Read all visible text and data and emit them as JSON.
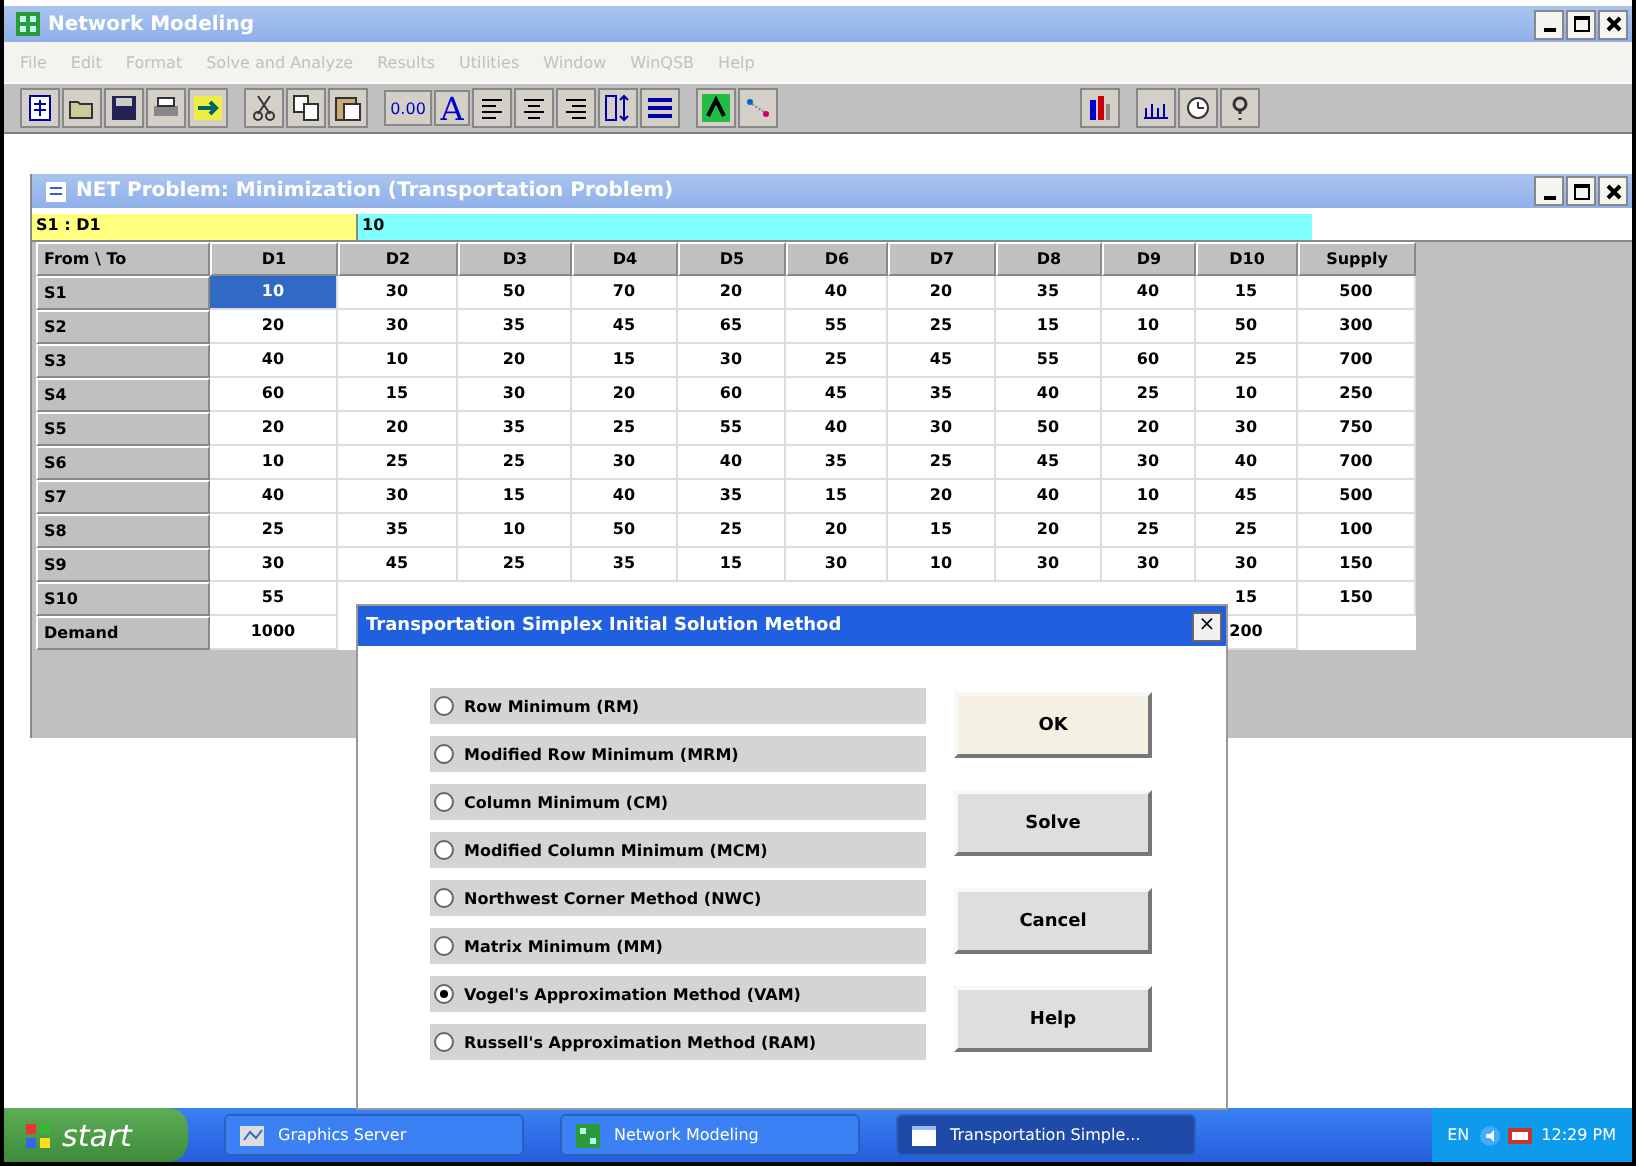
{
  "window": {
    "title": "Network Modeling"
  },
  "menu": [
    "File",
    "Edit",
    "Format",
    "Solve and Analyze",
    "Results",
    "Utilities",
    "Window",
    "WinQSB",
    "Help"
  ],
  "toolbar": {
    "number_format": "0.00",
    "font": "A"
  },
  "child_window": {
    "title": "NET Problem: Minimization (Transportation Problem)"
  },
  "formula_bar": {
    "cell": "S1 : D1",
    "value": "10"
  },
  "table": {
    "corner": "From \\ To",
    "columns": [
      "D1",
      "D2",
      "D3",
      "D4",
      "D5",
      "D6",
      "D7",
      "D8",
      "D9",
      "D10",
      "Supply"
    ],
    "rows": [
      {
        "label": "S1",
        "cells": [
          {
            "text": "10",
            "selected": true
          },
          {
            "text": "30",
            "selected": false
          },
          {
            "text": "50",
            "selected": false
          },
          {
            "text": "70",
            "selected": false
          },
          {
            "text": "20",
            "selected": false
          },
          {
            "text": "40",
            "selected": false
          },
          {
            "text": "20",
            "selected": false
          },
          {
            "text": "35",
            "selected": false
          },
          {
            "text": "40",
            "selected": false
          },
          {
            "text": "15",
            "selected": false
          },
          {
            "text": "500",
            "selected": false
          }
        ]
      },
      {
        "label": "S2",
        "cells": [
          {
            "text": "20",
            "selected": false
          },
          {
            "text": "30",
            "selected": false
          },
          {
            "text": "35",
            "selected": false
          },
          {
            "text": "45",
            "selected": false
          },
          {
            "text": "65",
            "selected": false
          },
          {
            "text": "55",
            "selected": false
          },
          {
            "text": "25",
            "selected": false
          },
          {
            "text": "15",
            "selected": false
          },
          {
            "text": "10",
            "selected": false
          },
          {
            "text": "50",
            "selected": false
          },
          {
            "text": "300",
            "selected": false
          }
        ]
      },
      {
        "label": "S3",
        "cells": [
          {
            "text": "40",
            "selected": false
          },
          {
            "text": "10",
            "selected": false
          },
          {
            "text": "20",
            "selected": false
          },
          {
            "text": "15",
            "selected": false
          },
          {
            "text": "30",
            "selected": false
          },
          {
            "text": "25",
            "selected": false
          },
          {
            "text": "45",
            "selected": false
          },
          {
            "text": "55",
            "selected": false
          },
          {
            "text": "60",
            "selected": false
          },
          {
            "text": "25",
            "selected": false
          },
          {
            "text": "700",
            "selected": false
          }
        ]
      },
      {
        "label": "S4",
        "cells": [
          {
            "text": "60",
            "selected": false
          },
          {
            "text": "15",
            "selected": false
          },
          {
            "text": "30",
            "selected": false
          },
          {
            "text": "20",
            "selected": false
          },
          {
            "text": "60",
            "selected": false
          },
          {
            "text": "45",
            "selected": false
          },
          {
            "text": "35",
            "selected": false
          },
          {
            "text": "40",
            "selected": false
          },
          {
            "text": "25",
            "selected": false
          },
          {
            "text": "10",
            "selected": false
          },
          {
            "text": "250",
            "selected": false
          }
        ]
      },
      {
        "label": "S5",
        "cells": [
          {
            "text": "20",
            "selected": false
          },
          {
            "text": "20",
            "selected": false
          },
          {
            "text": "35",
            "selected": false
          },
          {
            "text": "25",
            "selected": false
          },
          {
            "text": "55",
            "selected": false
          },
          {
            "text": "40",
            "selected": false
          },
          {
            "text": "30",
            "selected": false
          },
          {
            "text": "50",
            "selected": false
          },
          {
            "text": "20",
            "selected": false
          },
          {
            "text": "30",
            "selected": false
          },
          {
            "text": "750",
            "selected": false
          }
        ]
      },
      {
        "label": "S6",
        "cells": [
          {
            "text": "10",
            "selected": false
          },
          {
            "text": "25",
            "selected": false
          },
          {
            "text": "25",
            "selected": false
          },
          {
            "text": "30",
            "selected": false
          },
          {
            "text": "40",
            "selected": false
          },
          {
            "text": "35",
            "selected": false
          },
          {
            "text": "25",
            "selected": false
          },
          {
            "text": "45",
            "selected": false
          },
          {
            "text": "30",
            "selected": false
          },
          {
            "text": "40",
            "selected": false
          },
          {
            "text": "700",
            "selected": false
          }
        ]
      },
      {
        "label": "S7",
        "cells": [
          {
            "text": "40",
            "selected": false
          },
          {
            "text": "30",
            "selected": false
          },
          {
            "text": "15",
            "selected": false
          },
          {
            "text": "40",
            "selected": false
          },
          {
            "text": "35",
            "selected": false
          },
          {
            "text": "15",
            "selected": false
          },
          {
            "text": "20",
            "selected": false
          },
          {
            "text": "40",
            "selected": false
          },
          {
            "text": "10",
            "selected": false
          },
          {
            "text": "45",
            "selected": false
          },
          {
            "text": "500",
            "selected": false
          }
        ]
      },
      {
        "label": "S8",
        "cells": [
          {
            "text": "25",
            "selected": false
          },
          {
            "text": "35",
            "selected": false
          },
          {
            "text": "10",
            "selected": false
          },
          {
            "text": "50",
            "selected": false
          },
          {
            "text": "25",
            "selected": false
          },
          {
            "text": "20",
            "selected": false
          },
          {
            "text": "15",
            "selected": false
          },
          {
            "text": "20",
            "selected": false
          },
          {
            "text": "25",
            "selected": false
          },
          {
            "text": "25",
            "selected": false
          },
          {
            "text": "100",
            "selected": false
          }
        ]
      },
      {
        "label": "S9",
        "cells": [
          {
            "text": "30",
            "selected": false
          },
          {
            "text": "45",
            "selected": false
          },
          {
            "text": "25",
            "selected": false
          },
          {
            "text": "35",
            "selected": false
          },
          {
            "text": "15",
            "selected": false
          },
          {
            "text": "30",
            "selected": false
          },
          {
            "text": "10",
            "selected": false
          },
          {
            "text": "30",
            "selected": false
          },
          {
            "text": "30",
            "selected": false
          },
          {
            "text": "30",
            "selected": false
          },
          {
            "text": "150",
            "selected": false
          }
        ]
      },
      {
        "label": "S10",
        "cells": [
          {
            "text": "55",
            "selected": false
          },
          null,
          null,
          null,
          null,
          null,
          null,
          null,
          null,
          {
            "text": "15",
            "selected": false
          },
          {
            "text": "150",
            "selected": false
          }
        ]
      },
      {
        "label": "Demand",
        "cells": [
          {
            "text": "1000",
            "selected": false
          },
          null,
          null,
          null,
          null,
          null,
          null,
          null,
          null,
          {
            "text": "200",
            "selected": false
          },
          null
        ]
      }
    ]
  },
  "dialog": {
    "title": "Transportation Simplex Initial Solution Method",
    "close": "×",
    "options": [
      {
        "label": "Row Minimum (RM)",
        "selected": false
      },
      {
        "label": "Modified Row Minimum (MRM)",
        "selected": false
      },
      {
        "label": "Column Minimum (CM)",
        "selected": false
      },
      {
        "label": "Modified Column Minimum (MCM)",
        "selected": false
      },
      {
        "label": "Northwest Corner Method (NWC)",
        "selected": false
      },
      {
        "label": "Matrix Minimum (MM)",
        "selected": false
      },
      {
        "label": "Vogel's Approximation Method (VAM)",
        "selected": true
      },
      {
        "label": "Russell's Approximation Method (RAM)",
        "selected": false
      }
    ],
    "buttons": [
      "OK",
      "Solve",
      "Cancel",
      "Help"
    ]
  },
  "taskbar": {
    "start": "start",
    "tasks": [
      {
        "label": "Graphics Server",
        "selected": false
      },
      {
        "label": "Network Modeling",
        "selected": false
      },
      {
        "label": "Transportation Simple...",
        "selected": true
      }
    ],
    "language": "EN",
    "time": "12:29 PM"
  }
}
